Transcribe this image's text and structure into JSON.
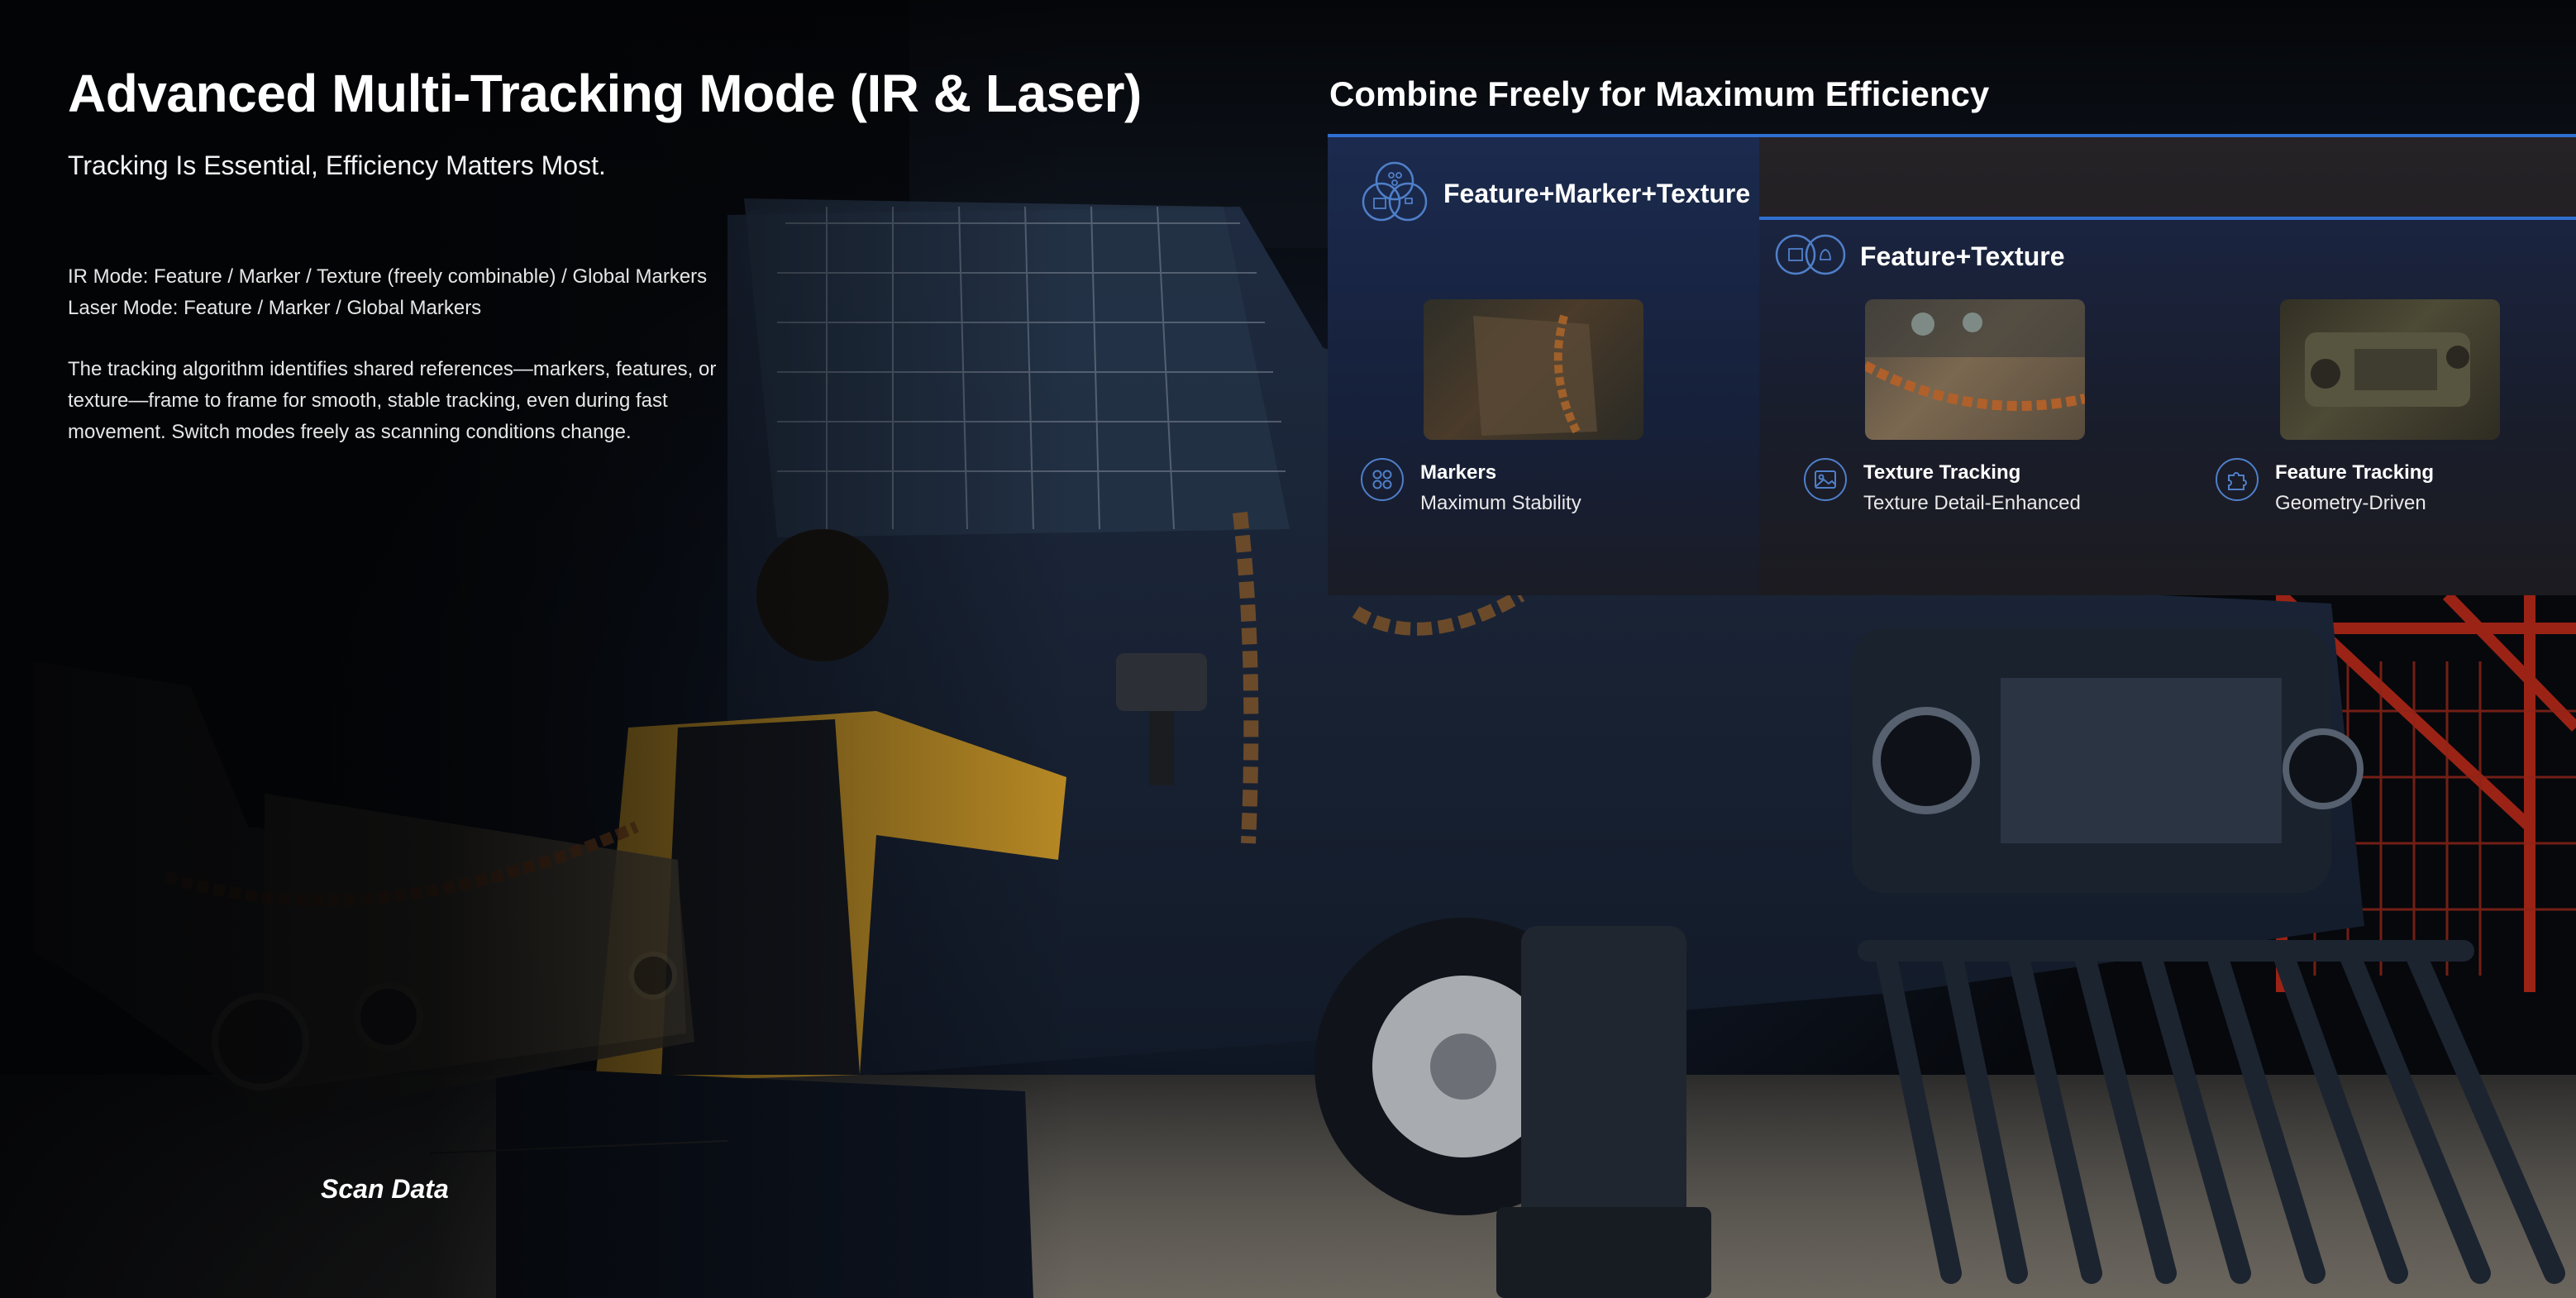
{
  "heading": {
    "title": "Advanced Multi-Tracking Mode (IR & Laser)",
    "subtitle": "Tracking Is Essential, Efficiency Matters Most."
  },
  "modes": {
    "ir": "IR Mode: Feature / Marker / Texture (freely combinable) / Global Markers",
    "laser": "Laser Mode: Feature / Marker / Global Markers"
  },
  "description": "The tracking algorithm identifies shared references—markers, features, or texture—frame to frame for smooth, stable tracking, even during fast movement. Switch modes freely as scanning conditions change.",
  "scan_label": "Scan Data",
  "panel": {
    "title": "Combine Freely for Maximum Efficiency",
    "combo_full": "Feature+Marker+Texture",
    "combo_partial": "Feature+Texture",
    "features": [
      {
        "title": "Markers",
        "subtitle": "Maximum Stability",
        "icon": "markers-icon"
      },
      {
        "title": "Texture Tracking",
        "subtitle": "Texture Detail-Enhanced",
        "icon": "image-icon"
      },
      {
        "title": "Feature Tracking",
        "subtitle": "Geometry-Driven",
        "icon": "puzzle-icon"
      }
    ]
  },
  "colors": {
    "accent": "#2f6fd1",
    "icon_stroke": "#4f7fc9",
    "panel_bg": "#1d1c22"
  }
}
